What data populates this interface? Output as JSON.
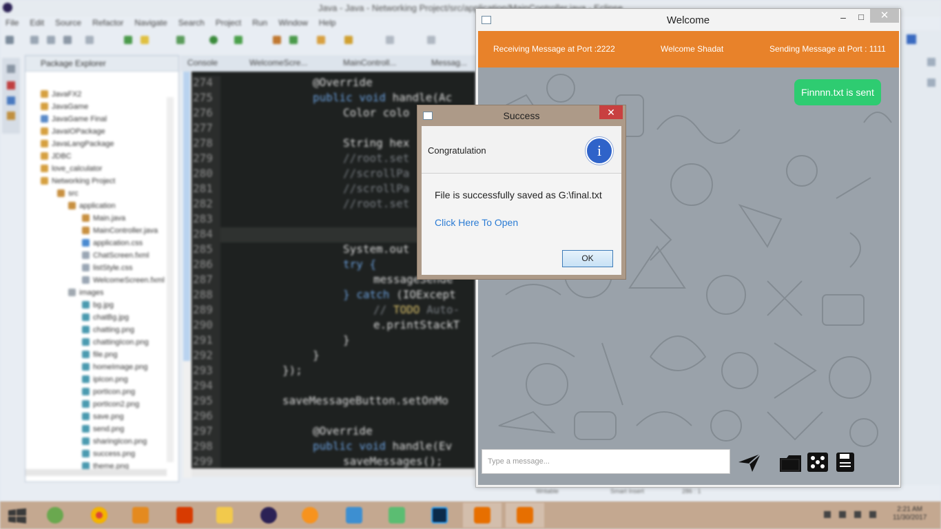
{
  "eclipse": {
    "title": "Java - Java - Networking Project/src/application/MainController.java - Eclipse",
    "menu": [
      "File",
      "Edit",
      "Source",
      "Refactor",
      "Navigate",
      "Search",
      "Project",
      "Run",
      "Window",
      "Help"
    ],
    "package_explorer": {
      "title": "Package Explorer",
      "items": [
        "JavaFX2",
        "JavaGame",
        "JavaGame Final",
        "JavaIOPackage",
        "JavaLangPackage",
        "JDBC",
        "love_calculator",
        "Networking Project",
        "src",
        "application",
        "Main.java",
        "MainController.java",
        "application.css",
        "ChatScreen.fxml",
        "listStyle.css",
        "WelcomeScreen.fxml",
        "images",
        "bg.jpg",
        "chatBg.jpg",
        "chatting.png",
        "chattingIcon.png",
        "file.png",
        "homeImage.png",
        "ipIcon.png",
        "portIcon.png",
        "portIcon2.png",
        "save.png",
        "send.png",
        "sharingIcon.png",
        "success.png",
        "theme.png"
      ]
    },
    "editor_tabs": [
      "Console",
      "WelcomeScre...",
      "MainControll...",
      "Messag..."
    ],
    "line_numbers": [
      "274",
      "275",
      "276",
      "277",
      "278",
      "279",
      "280",
      "281",
      "282",
      "283",
      "284",
      "285",
      "286",
      "287",
      "288",
      "289",
      "290",
      "291",
      "292",
      "293",
      "294",
      "295",
      "296",
      "297",
      "298",
      "299"
    ],
    "code": {
      "l274": "@Override",
      "l275a": "public void ",
      "l275b": "handle(Ac",
      "l276": "Color colo",
      "l278": "String hex",
      "l279": "//root.set",
      "l280": "//scrollPa",
      "l281": "//scrollPa",
      "l282": "//root.set",
      "l285": "System.out",
      "l286": "try {",
      "l287": "messageSende",
      "l288a": "} catch ",
      "l288b": "(IOExcept",
      "l289a": "// ",
      "l289b": "TODO",
      "l289c": " Auto-",
      "l290": "e.printStackT",
      "l291": "}",
      "l292": "}",
      "l293": "});",
      "l295": "saveMessageButton.setOnMo",
      "l297": "@Override",
      "l298a": "public void ",
      "l298b": "handle(Ev",
      "l299": "saveMessages();"
    },
    "status_items": [
      "Writable",
      "Smart Insert",
      "286 : 1"
    ]
  },
  "welcome": {
    "title": "Welcome",
    "header": {
      "receiving": "Receiving Message at Port :2222",
      "welcome_user": "Welcome Shadat",
      "sending": "Sending Message at Port : 1111"
    },
    "sent_message": "Finnnn.txt is sent",
    "input_placeholder": "Type a message...",
    "actions": [
      "send-icon",
      "folder-icon",
      "film-icon",
      "save-icon"
    ],
    "accent": "#e8822a",
    "bubble_color": "#2ecc71"
  },
  "dialog": {
    "title": "Success",
    "header_text": "Congratulation",
    "message": "File is successfully saved as G:\\final.txt",
    "link": "Click Here To Open",
    "ok_label": "OK",
    "info_glyph": "i"
  },
  "taskbar": {
    "time": "2:21 AM",
    "date": "11/30/2017"
  }
}
